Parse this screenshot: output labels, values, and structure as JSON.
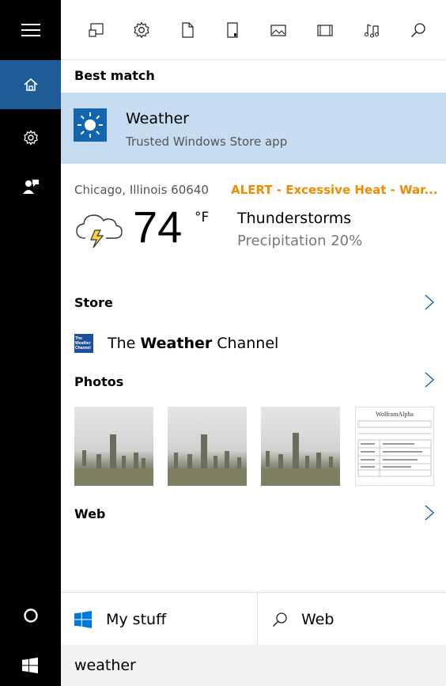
{
  "rail": {
    "items": [
      {
        "icon": "hamburger-menu-icon"
      },
      {
        "icon": "home-icon",
        "active": true
      },
      {
        "icon": "gear-icon"
      },
      {
        "icon": "feedback-icon"
      }
    ],
    "accent": "#1d5c96",
    "cortana_icon": "cortana-circle-icon",
    "start_icon": "windows-start-icon"
  },
  "toolbar": {
    "filters": [
      {
        "icon": "apps-filter-icon"
      },
      {
        "icon": "settings-filter-icon"
      },
      {
        "icon": "documents-filter-icon"
      },
      {
        "icon": "folders-filter-icon"
      },
      {
        "icon": "photos-filter-icon"
      },
      {
        "icon": "videos-filter-icon"
      },
      {
        "icon": "music-filter-icon"
      },
      {
        "icon": "search-icon"
      }
    ]
  },
  "best_match": {
    "section_label": "Best match",
    "title": "Weather",
    "subtitle": "Trusted Windows Store app",
    "icon": "weather-sun-icon",
    "highlight_color": "#c5dcf1"
  },
  "weather": {
    "location": "Chicago, Illinois 60640",
    "alert": "ALERT - Excessive Heat - War...",
    "alert_color": "#f08c00",
    "temperature": "74",
    "unit": "°F",
    "condition": "Thunderstorms",
    "precipitation": "Precipitation 20%",
    "icon": "thunderstorm-cloud-icon"
  },
  "store": {
    "section_label": "Store",
    "app_name_prefix": "The ",
    "app_name_bold": "Weather",
    "app_name_suffix": " Channel",
    "logo_text": "The Weather Channel"
  },
  "photos": {
    "section_label": "Photos",
    "thumbnails": [
      {
        "kind": "foggy-cemetery-photo"
      },
      {
        "kind": "foggy-cemetery-photo"
      },
      {
        "kind": "foggy-cemetery-photo"
      },
      {
        "kind": "wolframalpha-screenshot",
        "header_text": "WolframAlpha"
      }
    ]
  },
  "web": {
    "section_label": "Web"
  },
  "tabs": {
    "my_stuff": "My stuff",
    "web": "Web"
  },
  "search": {
    "query": "weather"
  }
}
